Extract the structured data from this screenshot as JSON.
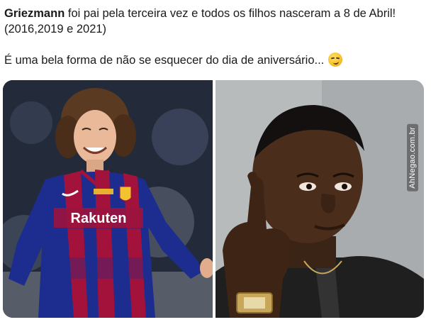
{
  "post": {
    "author_bold": "Griezmann",
    "line1_rest": " foi pai pela terceira vez e todos os filhos nasceram a 8 de Abril!",
    "line2": "(2016,2019 e 2021)",
    "line3": "É uma bela forma de não se esquecer do dia de aniversário...",
    "emoji": "smirking-face-emoji"
  },
  "media": {
    "left_image": {
      "description_icon": "footballer-photo",
      "jersey_sponsor": "Rakuten",
      "jersey_brand": "nike",
      "jersey_text": "Rakuten"
    },
    "right_image": {
      "description_icon": "man-pointing-head-meme-photo",
      "watermark": "AhNegao.com.br"
    }
  },
  "colors": {
    "text": "#1b1b1b",
    "jersey_blue": "#1c2d8f",
    "jersey_red": "#a3123a",
    "background": "#ffffff"
  }
}
